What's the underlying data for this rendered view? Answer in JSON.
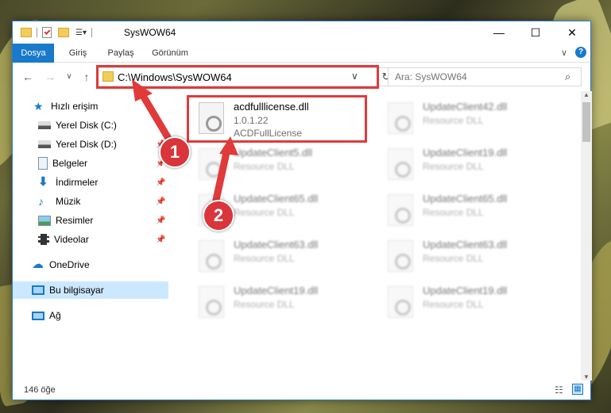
{
  "window": {
    "title": "SysWOW64",
    "controls": {
      "minimize": "—",
      "maximize": "☐",
      "close": "✕"
    }
  },
  "ribbon": {
    "tabs": [
      "Dosya",
      "Giriş",
      "Paylaş",
      "Görünüm"
    ]
  },
  "address": {
    "path": "C:\\Windows\\SysWOW64"
  },
  "search": {
    "placeholder": "Ara: SysWOW64"
  },
  "nav": {
    "items": [
      {
        "label": "Hızlı erişim",
        "icon": "star-icon",
        "pinned": false
      },
      {
        "label": "Yerel Disk (C:)",
        "icon": "drive-icon",
        "pinned": false
      },
      {
        "label": "Yerel Disk (D:)",
        "icon": "drive-icon",
        "pinned": true
      },
      {
        "label": "Belgeler",
        "icon": "document-icon",
        "pinned": true
      },
      {
        "label": "İndirmeler",
        "icon": "download-icon",
        "pinned": true
      },
      {
        "label": "Müzik",
        "icon": "music-icon",
        "pinned": true
      },
      {
        "label": "Resimler",
        "icon": "pictures-icon",
        "pinned": true
      },
      {
        "label": "Videolar",
        "icon": "video-icon",
        "pinned": true
      },
      {
        "label": "OneDrive",
        "icon": "cloud-icon",
        "pinned": false
      },
      {
        "label": "Bu bilgisayar",
        "icon": "computer-icon",
        "pinned": false
      },
      {
        "label": "Ağ",
        "icon": "network-icon",
        "pinned": false
      }
    ]
  },
  "files": [
    {
      "name": "acdfulllicense.dll",
      "version": "1.0.1.22",
      "desc": "ACDFullLicense"
    },
    {
      "name": "UpdateClient42.dll",
      "version": "Resource DLL",
      "desc": ""
    },
    {
      "name": "UpdateClient5.dll",
      "version": "Resource DLL",
      "desc": ""
    },
    {
      "name": "UpdateClient19.dll",
      "version": "Resource DLL",
      "desc": ""
    },
    {
      "name": "UpdateClient65.dll",
      "version": "Resource DLL",
      "desc": ""
    },
    {
      "name": "UpdateClient65.dll",
      "version": "Resource DLL",
      "desc": ""
    },
    {
      "name": "UpdateClient63.dll",
      "version": "Resource DLL",
      "desc": ""
    },
    {
      "name": "UpdateClient63.dll",
      "version": "Resource DLL",
      "desc": ""
    },
    {
      "name": "UpdateClient19.dll",
      "version": "Resource DLL",
      "desc": ""
    },
    {
      "name": "UpdateClient19.dll",
      "version": "Resource DLL",
      "desc": ""
    }
  ],
  "status": {
    "count": "146 öğe"
  },
  "annotations": {
    "step1": "1",
    "step2": "2"
  },
  "colors": {
    "accent": "#1979ca",
    "highlight": "#e03a3a",
    "selected_bg": "#cce8ff"
  }
}
